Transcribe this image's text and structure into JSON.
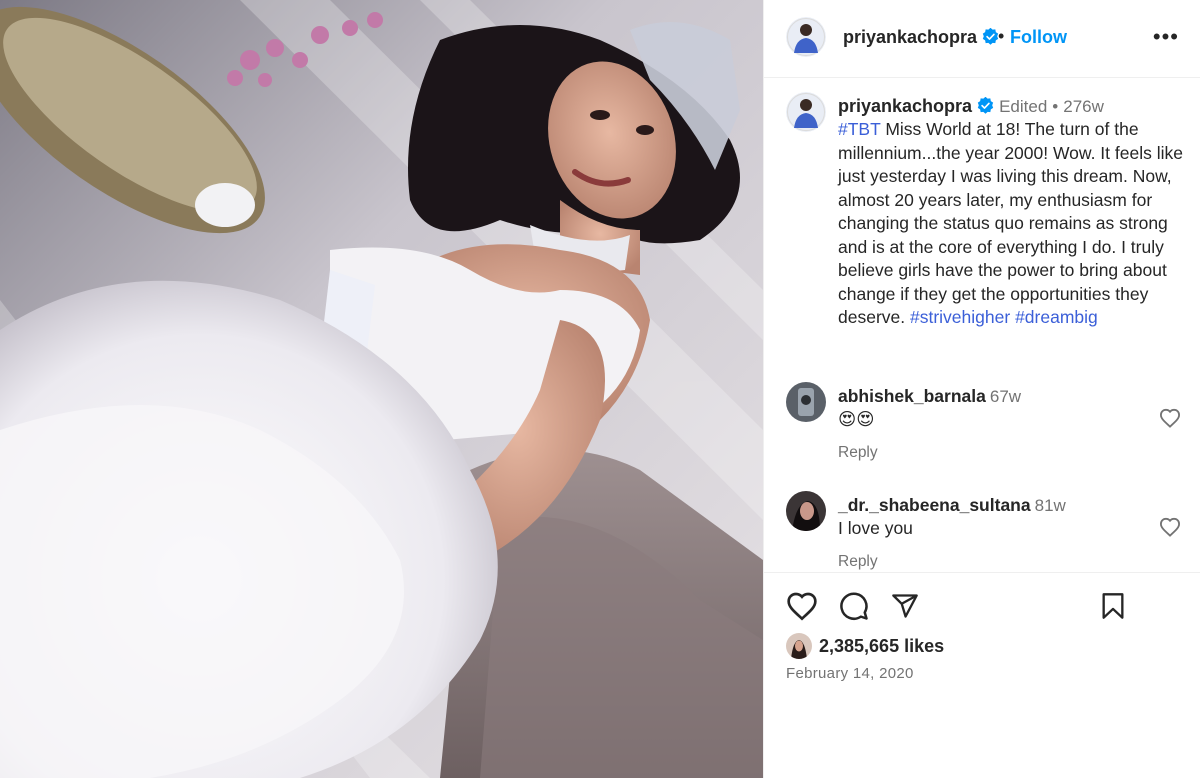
{
  "post": {
    "username": "priyankachopra",
    "follow_label": "Follow",
    "more_label": "•••",
    "dot": "•"
  },
  "caption": {
    "username": "priyankachopra",
    "edited": "Edited",
    "sep": "•",
    "age": "276w",
    "tag_tbt": "#TBT",
    "body": " Miss World at 18! The turn of the millennium...the year 2000! Wow. It feels like just yesterday I was living this dream. Now, almost 20 years later, my enthusiasm for changing the status quo remains as strong and is at the core of everything I do. I truly believe girls have the power to bring about change if they get the opportunities they deserve. ",
    "tag_strive": "#strivehigher",
    "tag_dream": "#dreambig"
  },
  "comments": [
    {
      "username": "abhishek_barnala",
      "age": "67w",
      "text": "😍😍",
      "reply_label": "Reply"
    },
    {
      "username": "_dr._shabeena_sultana",
      "age": "81w",
      "text": "I love you",
      "reply_label": "Reply"
    }
  ],
  "stats": {
    "likes": "2,385,665 likes",
    "date": "February 14, 2020"
  },
  "icons": {
    "verified": "verified-badge-icon",
    "like": "heart-icon",
    "comment": "comment-bubble-icon",
    "share": "paper-plane-icon",
    "save": "bookmark-icon",
    "more": "more-options-icon"
  },
  "colors": {
    "link_blue": "#0095f6",
    "hashtag": "#3b5fd8",
    "verified": "#0095f6",
    "muted": "#737373",
    "text": "#262626"
  }
}
